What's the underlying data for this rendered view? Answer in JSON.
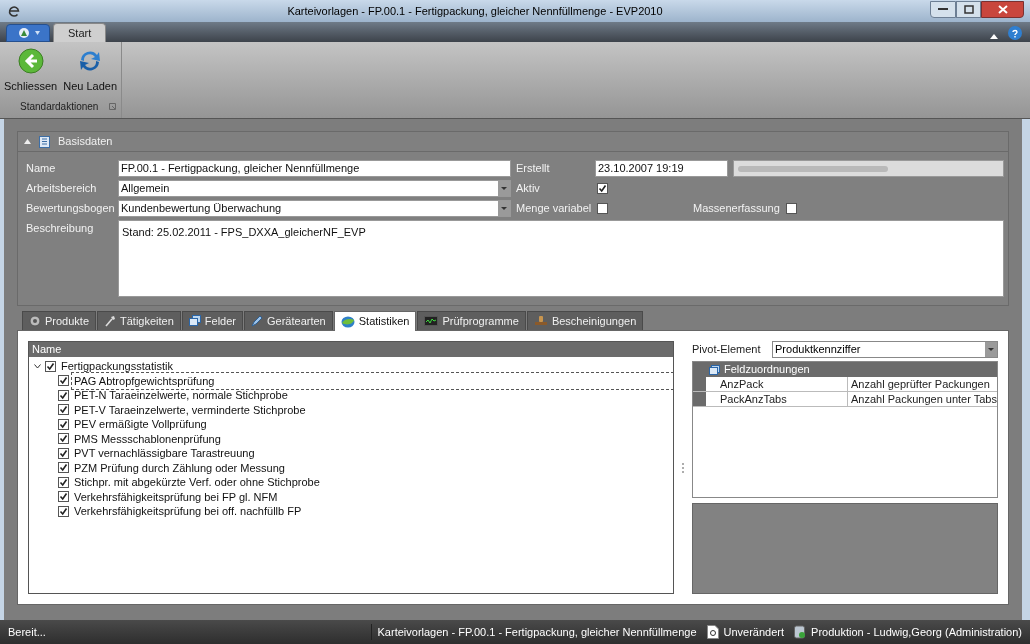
{
  "window": {
    "title": "Karteivorlagen - FP.00.1 - Fertigpackung, gleicher Nennfüllmenge - EVP2010"
  },
  "ribbon": {
    "tabs": [
      {
        "label": "Start",
        "selected": true
      }
    ],
    "buttons": [
      {
        "label": "Schliessen",
        "kind": "back"
      },
      {
        "label": "Neu Laden",
        "kind": "reload"
      }
    ],
    "group": "Standardaktionen"
  },
  "basisdaten": {
    "title": "Basisdaten",
    "expanded": true,
    "name": {
      "label": "Name",
      "value": "FP.00.1 - Fertigpackung, gleicher Nennfüllmenge"
    },
    "arbeitsbereich": {
      "label": "Arbeitsbereich",
      "value": "Allgemein"
    },
    "bewertungsbogen": {
      "label": "Bewertungsbogen",
      "value": "Kundenbewertung Überwachung"
    },
    "beschreibung": {
      "label": "Beschreibung",
      "value": "Stand: 25.02.2011 - FPS_DXXA_gleicherNF_EVP"
    },
    "erstellt": {
      "label": "Erstellt",
      "value": "23.10.2007 19:19"
    },
    "aktiv": {
      "label": "Aktiv",
      "checked": true
    },
    "menge_variabel": {
      "label": "Menge variabel",
      "checked": false
    },
    "massenerfassung": {
      "label": "Massenerfassung",
      "checked": false
    }
  },
  "tabs": [
    {
      "label": "Produkte",
      "kind": "gear",
      "selected": false
    },
    {
      "label": "Tätigkeiten",
      "kind": "tool",
      "selected": false
    },
    {
      "label": "Felder",
      "kind": "window",
      "selected": false
    },
    {
      "label": "Gerätearten",
      "kind": "pen",
      "selected": false
    },
    {
      "label": "Statistiken",
      "kind": "chart",
      "selected": true
    },
    {
      "label": "Prüfprogramme",
      "kind": "monitor",
      "selected": false
    },
    {
      "label": "Bescheinigungen",
      "kind": "stamp",
      "selected": false
    }
  ],
  "tree": {
    "column": "Name",
    "items": [
      {
        "label": "Fertigpackungsstatistik",
        "checked": true,
        "expanded": true,
        "selected": false,
        "children": [
          {
            "label": "PAG Abtropfgewichtsprüfung",
            "checked": true,
            "selected": true
          },
          {
            "label": "PET-N Taraeinzelwerte, normale Stichprobe",
            "checked": true,
            "selected": false
          },
          {
            "label": "PET-V Taraeinzelwerte, verminderte Stichprobe",
            "checked": true,
            "selected": false
          },
          {
            "label": "PEV ermäßigte Vollprüfung",
            "checked": true,
            "selected": false
          },
          {
            "label": "PMS Messschablonenprüfung",
            "checked": true,
            "selected": false
          },
          {
            "label": "PVT vernachlässigbare Tarastreuung",
            "checked": true,
            "selected": false
          },
          {
            "label": "PZM Prüfung durch Zählung oder Messung",
            "checked": true,
            "selected": false
          },
          {
            "label": "Stichpr. mit abgekürzte Verf. oder ohne Stichprobe",
            "checked": true,
            "selected": false
          },
          {
            "label": "Verkehrsfähigkeitsprüfung bei FP gl. NFM",
            "checked": true,
            "selected": false
          },
          {
            "label": "Verkehrsfähigkeitsprüfung bei off. nachfüllb FP",
            "checked": true,
            "selected": false
          }
        ]
      }
    ]
  },
  "pivot": {
    "label": "Pivot-Element",
    "value": "Produktkennziffer"
  },
  "feldzuordnungen": {
    "title": "Feldzuordnungen",
    "rows": [
      [
        "AnzPack",
        "Anzahl geprüfter Packungen"
      ],
      [
        "PackAnzTabs",
        "Anzahl Packungen unter Tabs"
      ]
    ]
  },
  "status_bar": {
    "left": "Bereit...",
    "document": "Karteivorlagen - FP.00.1 - Fertigpackung, gleicher Nennfüllmenge",
    "state": "Unverändert",
    "connection": "Produktion - Ludwig,Georg (Administration)"
  }
}
